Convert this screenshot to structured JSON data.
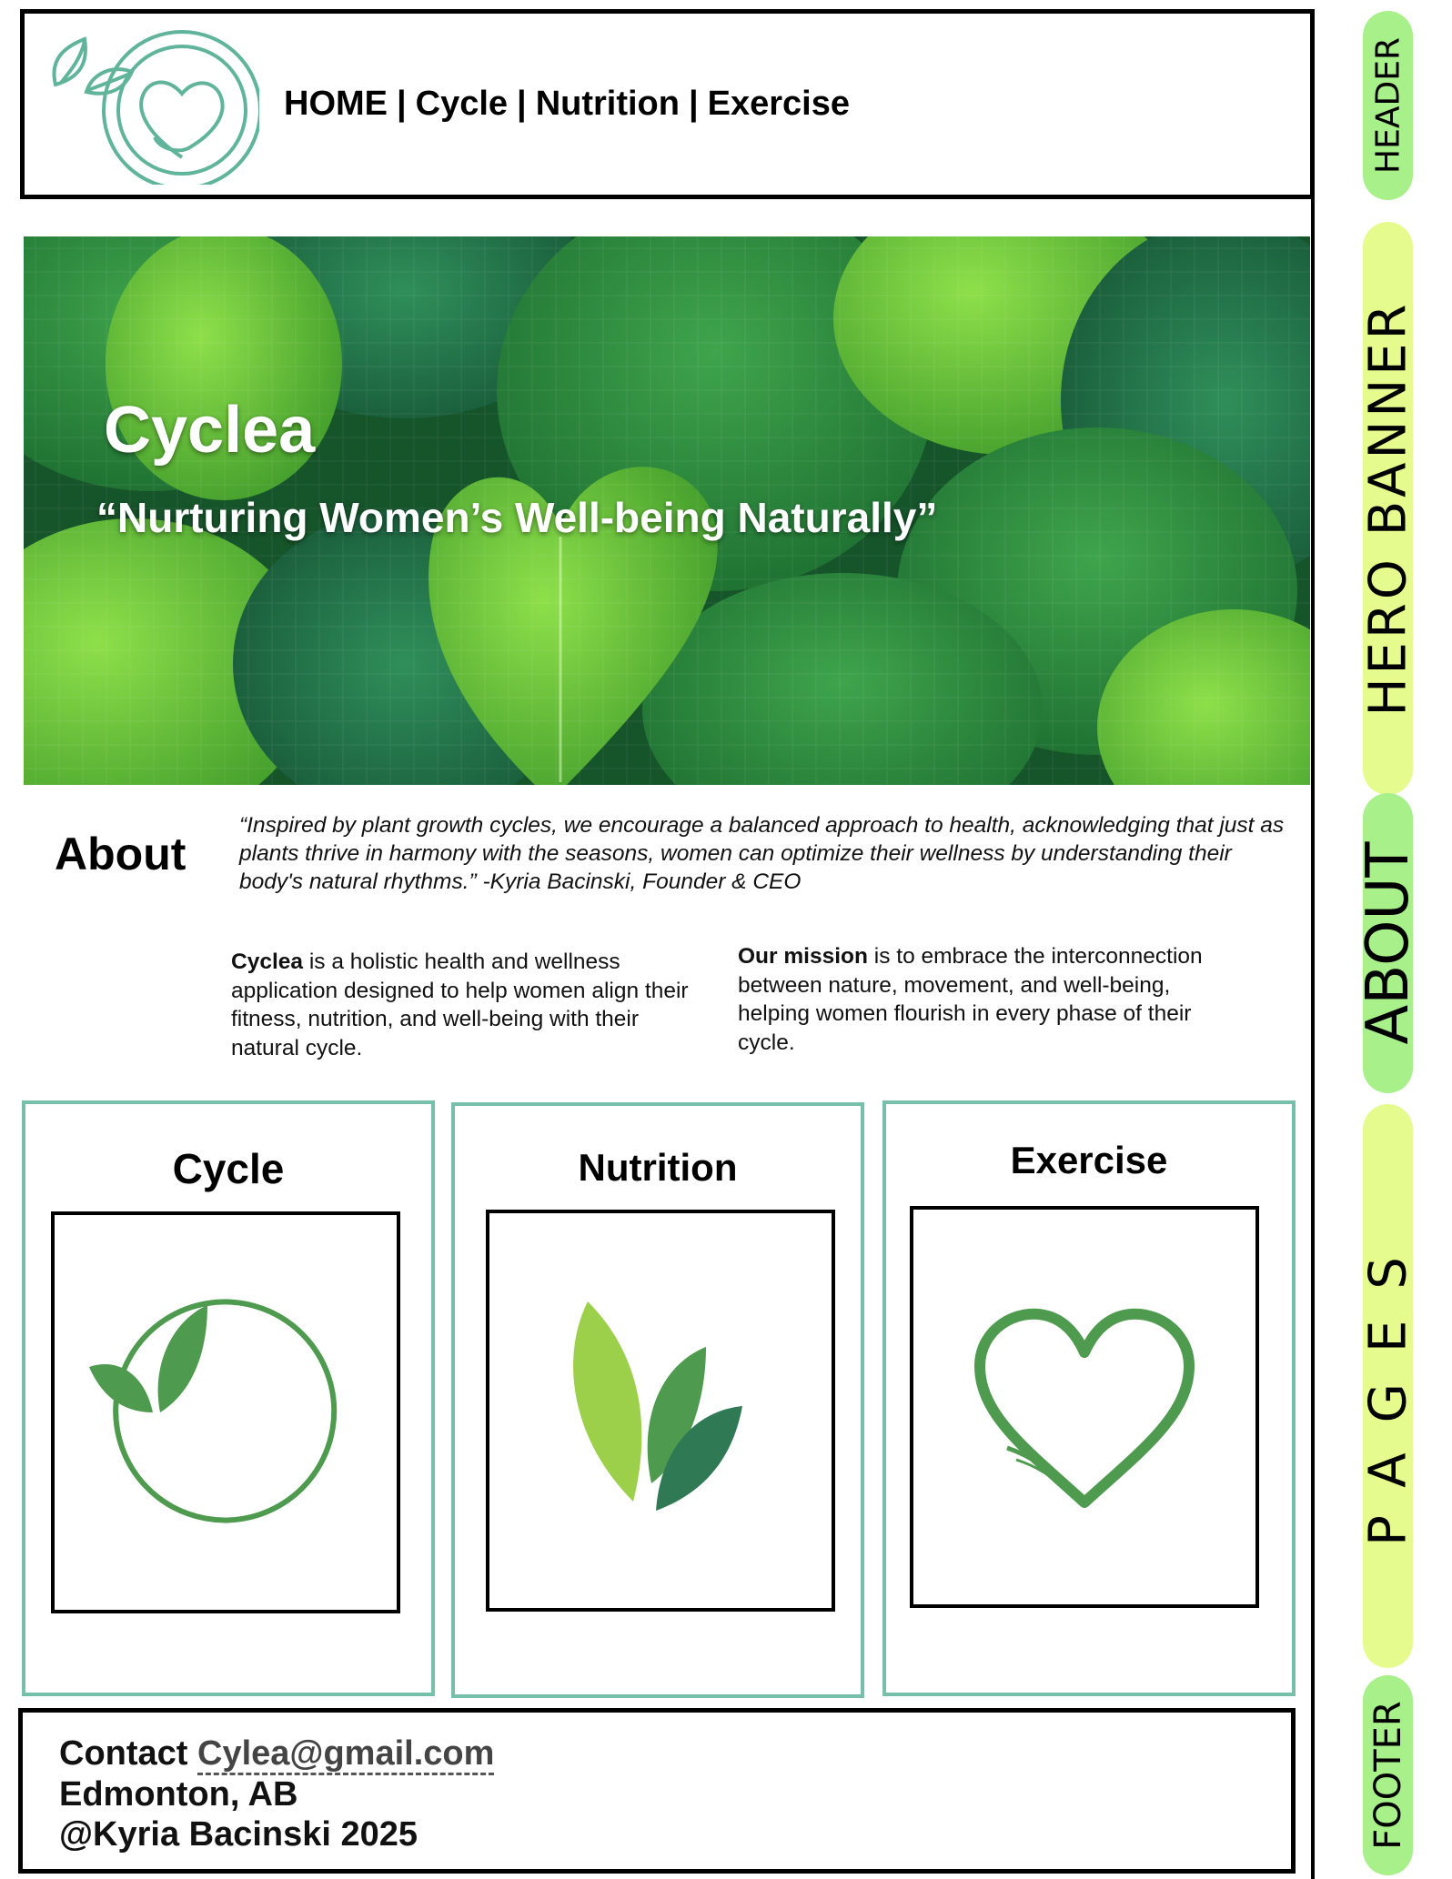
{
  "header": {
    "nav": [
      "HOME",
      "Cycle",
      "Nutrition",
      "Exercise"
    ],
    "separator": "|"
  },
  "hero": {
    "title": "Cyclea",
    "tagline": "“Nurturing Women’s Well-being Naturally”"
  },
  "about": {
    "heading": "About",
    "quote": "“Inspired by plant growth cycles, we encourage a balanced approach to health, acknowledging that just as plants thrive in harmony with the seasons, women can optimize their wellness by understanding their body's natural rhythms.” -Kyria Bacinski, Founder & CEO",
    "left": {
      "bold": "Cyclea",
      "text": " is a holistic health and wellness application designed to help women align their fitness, nutrition, and well-being with their natural cycle."
    },
    "right": {
      "bold": "Our mission",
      "text": " is to embrace the interconnection between nature, movement, and well-being, helping women flourish in every phase of their cycle."
    }
  },
  "cards": [
    {
      "title": "Cycle",
      "icon": "leaf-circle-icon"
    },
    {
      "title": "Nutrition",
      "icon": "leaves-icon"
    },
    {
      "title": "Exercise",
      "icon": "heart-icon"
    }
  ],
  "footer": {
    "contact_label": "Contact",
    "email": "Cylea@gmail.com",
    "location": "Edmonton, AB",
    "copyright": "@Kyria Bacinski 2025"
  },
  "sidebar": {
    "labels": [
      "HEADER",
      "HERO BANNER",
      "ABOUT",
      "PAGES",
      "FOOTER"
    ],
    "colors": {
      "green": "#a8f08a",
      "yellow": "#e6fb8e"
    }
  },
  "colors": {
    "logo_teal": "#5fb49a",
    "card_border": "#76bfa8",
    "icon_green": "#4e9a4f"
  }
}
